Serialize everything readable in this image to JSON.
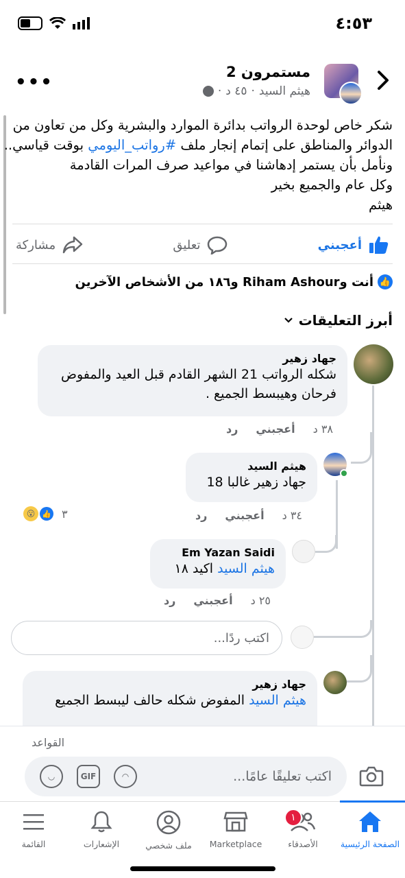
{
  "status": {
    "time": "٤:٥٣"
  },
  "post": {
    "group_name": "مستمرون 2",
    "author": "هيثم السيد",
    "age": "٤٥ د",
    "body": {
      "line1": "شكر خاص لوحدة الرواتب بدائرة الموارد والبشرية وكل من تعاون من",
      "line2_pre": "الدوائر والمناطق على إتمام إنجار ملف ",
      "hashtag": "#رواتب_اليومي",
      "line2_post": " بوقت قياسي..",
      "line3": "ونأمل بأن يستمر إدهاشنا في مواعيد صرف المرات القادمة",
      "line4": "وكل عام  والجميع بخير",
      "line5": "هيثم"
    },
    "actions": {
      "like": "أعجبني",
      "comment": "تعليق",
      "share": "مشاركة"
    },
    "reactions_text": "أنت وRiham Ashour و١٨٦ من الأشخاص الآخرين"
  },
  "comments_header": "أبرز التعليقات",
  "comments": [
    {
      "author": "جهاد زهير",
      "line1": "شكله الرواتب  21 الشهر القادم قبل العيد والمفوض",
      "line2": "فرحان وهيبسط الجميع .",
      "time": "٣٨ د",
      "like": "أعجبني",
      "reply": "رد"
    },
    {
      "author": "هيثم السيد",
      "mention": "جهاد زهير",
      "text": " غالبا 18",
      "time": "٣٤ د",
      "like": "أعجبني",
      "reply": "رد",
      "reaction_count": "٣"
    },
    {
      "author": "Em Yazan Saidi",
      "mention": "هيثم السيد",
      "text": "  اكيد ١٨",
      "time": "٢٥ د",
      "like": "أعجبني",
      "reply": "رد"
    },
    {
      "author": "جهاد زهير",
      "mention": "هيثم السيد",
      "text": " المفوض شكله حالف ليبسط الجميع"
    }
  ],
  "reply_placeholder": "اكتب ردًا...",
  "composer": {
    "rules": "القواعد",
    "placeholder": "اكتب تعليقًا عامًا...",
    "gif": "GIF"
  },
  "tabs": {
    "home": "الصفحة الرئيسية",
    "friends": "الأصدقاء",
    "friends_badge": "١",
    "marketplace": "Marketplace",
    "profile": "ملف شخصي",
    "notifications": "الإشعارات",
    "menu": "القائمة"
  },
  "colors": {
    "accent": "#1877f2",
    "link": "#1b74e4",
    "bubble": "#f0f2f5",
    "muted": "#65676b",
    "badge": "#e41e3f"
  }
}
